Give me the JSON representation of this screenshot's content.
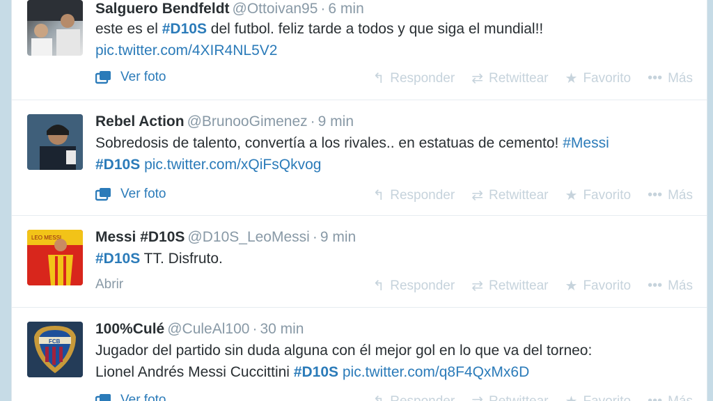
{
  "actions": {
    "reply": "Responder",
    "retweet": "Retwittear",
    "favorite": "Favorito",
    "more": "Más"
  },
  "tweets": [
    {
      "fullname": "Salguero Bendfeldt",
      "username": "@Ottoivan95",
      "time": "6 min",
      "text_1": "este es el ",
      "hashtag_1": "#D10S",
      "text_2": " del futbol. feliz tarde a todos y que siga el mundial!!",
      "link": "pic.twitter.com/4XIR4NL5V2",
      "expand_label": "Ver foto"
    },
    {
      "fullname": "Rebel Action",
      "username": "@BrunooGimenez",
      "time": "9 min",
      "text_1": "Sobredosis de talento, convertía a los rivales.. en estatuas de cemento! ",
      "hashtag_1": "#Messi",
      "hashtag_2": "#D10S",
      "link": "pic.twitter.com/xQiFsQkvog",
      "expand_label": "Ver foto"
    },
    {
      "fullname": "Messi #D10S",
      "username": "@D10S_LeoMessi",
      "time": "9 min",
      "hashtag_1": "#D10S",
      "text_1": " TT. Disfruto.",
      "expand_label": "Abrir",
      "avatar_text": "LEO MESSI"
    },
    {
      "fullname": "100%Culé",
      "username": "@CuleAl100",
      "time": "30 min",
      "text_1": "Jugador del partido sin duda alguna con él mejor gol en lo que va del torneo:",
      "text_2": "Lionel Andrés Messi Cuccittini ",
      "hashtag_1": "#D10S",
      "link": "pic.twitter.com/q8F4QxMx6D",
      "expand_label": "Ver foto",
      "avatar_text": "FCB"
    }
  ],
  "colors": {
    "link": "#2b7bb9",
    "muted": "#8899a6",
    "action": "#c6d3dc",
    "background": "#c6dbe6"
  }
}
